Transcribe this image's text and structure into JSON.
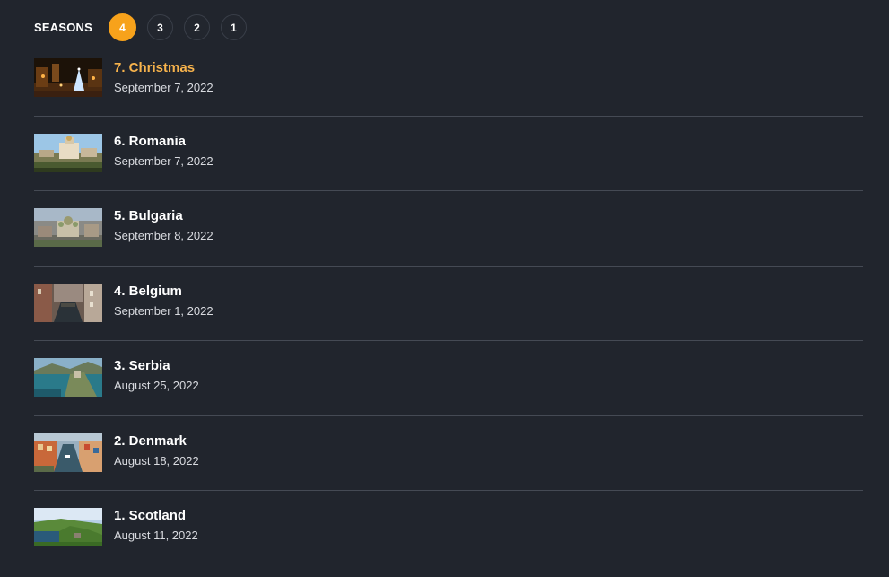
{
  "seasons": {
    "label": "SEASONS",
    "items": [
      {
        "label": "4",
        "active": true
      },
      {
        "label": "3",
        "active": false
      },
      {
        "label": "2",
        "active": false
      },
      {
        "label": "1",
        "active": false
      }
    ]
  },
  "episodes": [
    {
      "title": "7. Christmas",
      "date": "September 7, 2022",
      "current": true
    },
    {
      "title": "6. Romania",
      "date": "September 7, 2022",
      "current": false
    },
    {
      "title": "5. Bulgaria",
      "date": "September 8, 2022",
      "current": false
    },
    {
      "title": "4. Belgium",
      "date": "September 1, 2022",
      "current": false
    },
    {
      "title": "3. Serbia",
      "date": "August 25, 2022",
      "current": false
    },
    {
      "title": "2. Denmark",
      "date": "August 18, 2022",
      "current": false
    },
    {
      "title": "1. Scotland",
      "date": "August 11, 2022",
      "current": false
    }
  ],
  "colors": {
    "background": "#21252d",
    "accent": "#f7a21b",
    "current_title": "#f7b34c",
    "divider": "#454a54"
  }
}
